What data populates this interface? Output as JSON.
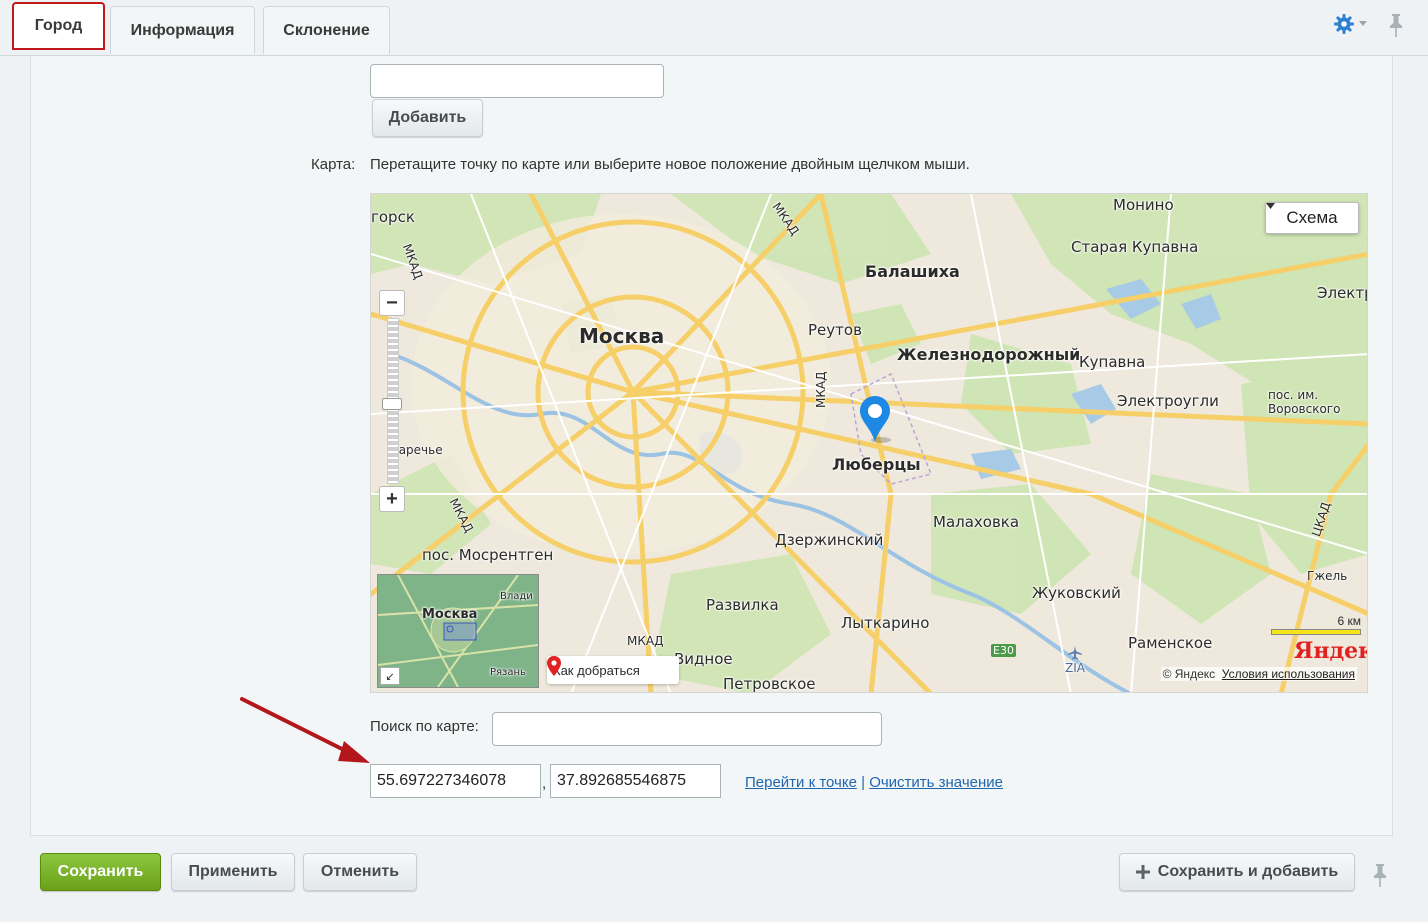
{
  "tabs": [
    {
      "label": "Город",
      "active": true
    },
    {
      "label": "Информация",
      "active": false
    },
    {
      "label": "Склонение",
      "active": false
    }
  ],
  "toolbar": {
    "settings_icon": "gear-icon",
    "pin_icon": "pin-icon"
  },
  "form": {
    "top_input_value": "",
    "add_button": "Добавить",
    "map_label": "Карта:",
    "map_hint": "Перетащите точку по карте или выберите новое положение двойным щелчком мыши.",
    "search_label": "Поиск по карте:",
    "search_value": "",
    "lat": "55.697227346078",
    "separator": ",",
    "lng": "37.892685546875",
    "goto_link": "Перейти к точке",
    "link_sep": "|",
    "clear_link": "Очистить значение"
  },
  "map": {
    "type_button": "Схема",
    "zoom_in": "+",
    "zoom_out": "−",
    "route_label": "Как добраться",
    "copyright": "© Яндекс",
    "terms_link": "Условия использования",
    "scale_label": "6 км",
    "logo": "Яндекс",
    "minimap_labels": [
      "Москва",
      "Влади",
      "Рязань"
    ],
    "labels": {
      "moscow": "Москва",
      "balashikha": "Балашиха",
      "reutov": "Реутов",
      "zheleznodorozhny": "Железнодорожный",
      "lyubertsy": "Люберцы",
      "monino": "Монино",
      "staraya_kupavna": "Старая Купавна",
      "kupavna": "Купавна",
      "elektrougli": "Электроугли",
      "elektr": "Электр",
      "vorovskogo": "пос. им. Воровского",
      "malakhovka": "Малаховка",
      "dzerzhinsky": "Дзержинский",
      "mosrentgen": "пос. Мосрентген",
      "razvilka": "Развилка",
      "lytkarino": "Лыткарино",
      "zhukovsky": "Жуковский",
      "ramenskoe": "Раменское",
      "vidnoe": "Видное",
      "petrovskoe": "Петровское",
      "gzhel": "Гжель",
      "zarechye": "Заречье",
      "gorsk": "горск",
      "mkad1": "МКАД",
      "mkad2": "МКАД",
      "mkad3": "МКАД",
      "mkad4": "МКАД",
      "mkad5": "МКАД",
      "ckad": "ЦКАД",
      "e30": "E30",
      "zia": "ZIA"
    }
  },
  "actions": {
    "save": "Сохранить",
    "apply": "Применить",
    "cancel": "Отменить",
    "save_and_add": "Сохранить и добавить"
  },
  "colors": {
    "active_tab_border": "#c0191b",
    "save_green": "#7ab32e",
    "link_blue": "#2067b0",
    "arrow_red": "#b3161b"
  }
}
